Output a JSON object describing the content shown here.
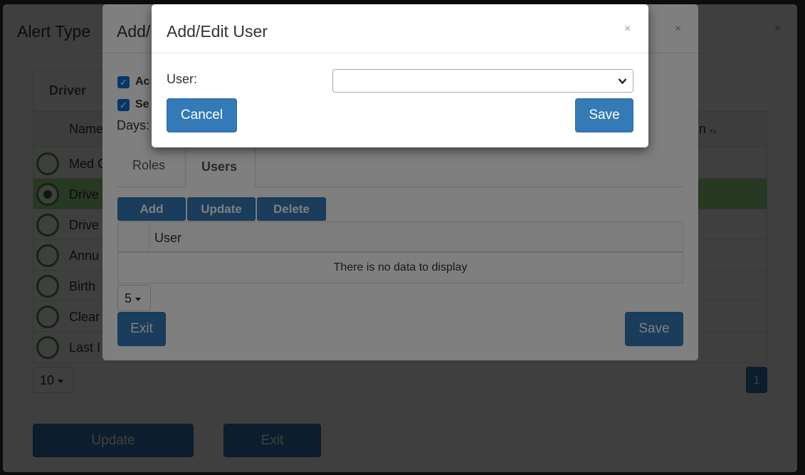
{
  "base": {
    "title": "Alert Type",
    "tab": "Driver",
    "col_name": "Name",
    "col_right": "n",
    "rows": [
      "Med C",
      "Drive",
      "Drive",
      "Annu",
      "Birth",
      "Clear",
      "Last I"
    ],
    "page_size": "10",
    "page": "1",
    "update": "Update",
    "exit": "Exit"
  },
  "modal2": {
    "title": "Add/",
    "cb1": "Ac",
    "cb2": "Se",
    "days": "Days:",
    "tab_roles": "Roles",
    "tab_users": "Users",
    "add": "Add",
    "update": "Update",
    "delete": "Delete",
    "col_user": "User",
    "empty": "There is no data to display",
    "page_size": "5",
    "exit": "Exit",
    "save": "Save"
  },
  "modal3": {
    "title": "Add/Edit User",
    "user_label": "User:",
    "select_value": "",
    "cancel": "Cancel",
    "save": "Save"
  },
  "icons": {
    "close": "×",
    "check": "✓"
  }
}
